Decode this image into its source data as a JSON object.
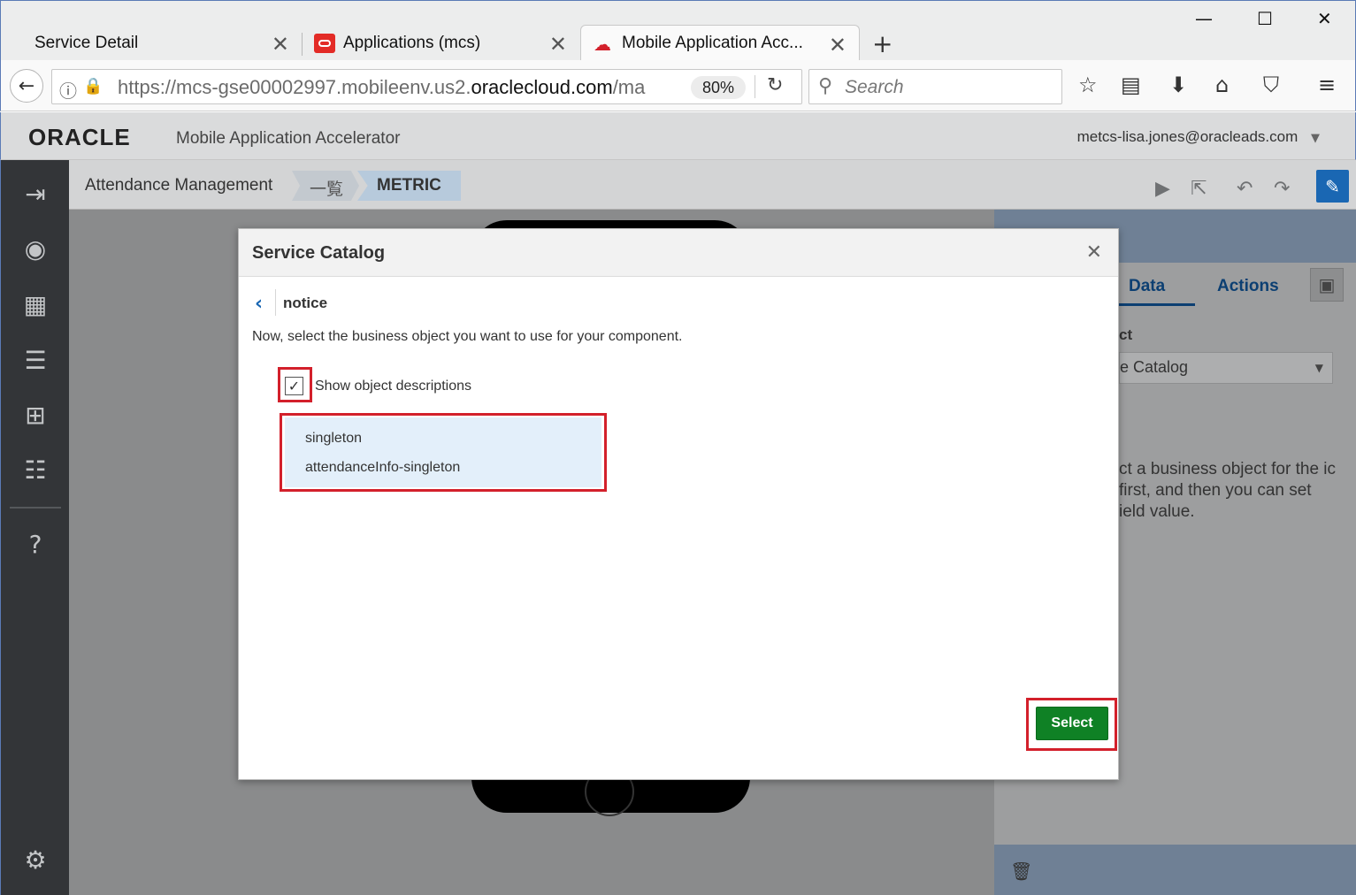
{
  "browser": {
    "tabs": [
      {
        "title": "Service Detail"
      },
      {
        "title": "Applications (mcs)"
      },
      {
        "title": "Mobile Application Acc..."
      }
    ],
    "url_prefix": "https://mcs-gse00002997.mobileenv.us2.",
    "url_domain": "oraclecloud.com",
    "url_suffix": "/ma",
    "zoom": "80%",
    "search_placeholder": "Search"
  },
  "app": {
    "brand": "ORACLE",
    "title": "Mobile Application Accelerator",
    "user": "metcs-lisa.jones@oracleads.com"
  },
  "breadcrumb": {
    "project": "Attendance Management",
    "page": "一覧",
    "current": "METRIC"
  },
  "right_panel": {
    "tabs": [
      "Data",
      "Actions"
    ],
    "label_partial": "ct",
    "select_partial": "e Catalog",
    "description_partial": "ct a business object for the ic first, and then you can set ield value."
  },
  "dialog": {
    "title": "Service Catalog",
    "back_crumb": "notice",
    "instruction": "Now, select the business object you want to use for your component.",
    "checkbox_label": "Show object descriptions",
    "checkbox_checked": true,
    "objects": [
      "singleton",
      "attendanceInfo-singleton"
    ],
    "select_button": "Select"
  },
  "colors": {
    "accent": "#1a67b3",
    "primary_button": "#0f8125",
    "highlight": "#d3202b"
  }
}
